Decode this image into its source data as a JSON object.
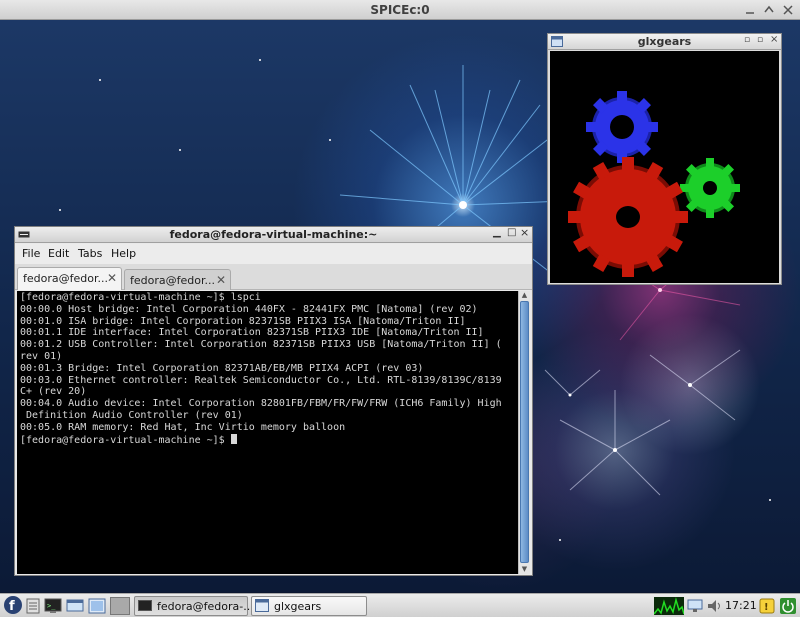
{
  "outer_window": {
    "title": "SPICEc:0"
  },
  "glxgears": {
    "title": "glxgears",
    "gear_colors": {
      "large": "#c81a0b",
      "small_right": "#1ccf2a",
      "small_top": "#2430ea"
    }
  },
  "terminal": {
    "title": "fedora@fedora-virtual-machine:~",
    "menu": [
      "File",
      "Edit",
      "Tabs",
      "Help"
    ],
    "tabs": [
      {
        "label": "fedora@fedor...",
        "active": true
      },
      {
        "label": "fedora@fedor...",
        "active": false
      }
    ],
    "lines": [
      "[fedora@fedora-virtual-machine ~]$ lspci",
      "00:00.0 Host bridge: Intel Corporation 440FX - 82441FX PMC [Natoma] (rev 02)",
      "00:01.0 ISA bridge: Intel Corporation 82371SB PIIX3 ISA [Natoma/Triton II]",
      "00:01.1 IDE interface: Intel Corporation 82371SB PIIX3 IDE [Natoma/Triton II]",
      "00:01.2 USB Controller: Intel Corporation 82371SB PIIX3 USB [Natoma/Triton II] (",
      "rev 01)",
      "00:01.3 Bridge: Intel Corporation 82371AB/EB/MB PIIX4 ACPI (rev 03)",
      "00:03.0 Ethernet controller: Realtek Semiconductor Co., Ltd. RTL-8139/8139C/8139",
      "C+ (rev 20)",
      "00:04.0 Audio device: Intel Corporation 82801FB/FBM/FR/FW/FRW (ICH6 Family) High",
      " Definition Audio Controller (rev 01)",
      "00:05.0 RAM memory: Red Hat, Inc Virtio memory balloon"
    ],
    "prompt": "[fedora@fedora-virtual-machine ~]$ "
  },
  "taskbar": {
    "tasks": [
      {
        "label": "fedora@fedora-...",
        "active": true
      },
      {
        "label": "glxgears",
        "active": false
      }
    ],
    "clock": "17:21"
  },
  "icons": {
    "start": "fedora-logo-icon",
    "launchers": [
      "file-manager-icon",
      "terminal-icon",
      "browser-icon",
      "show-desktop-icon",
      "workspace-switcher-icon"
    ],
    "tray": [
      "system-monitor-icon",
      "network-icon",
      "volume-icon",
      "updates-icon",
      "shutdown-icon"
    ]
  }
}
